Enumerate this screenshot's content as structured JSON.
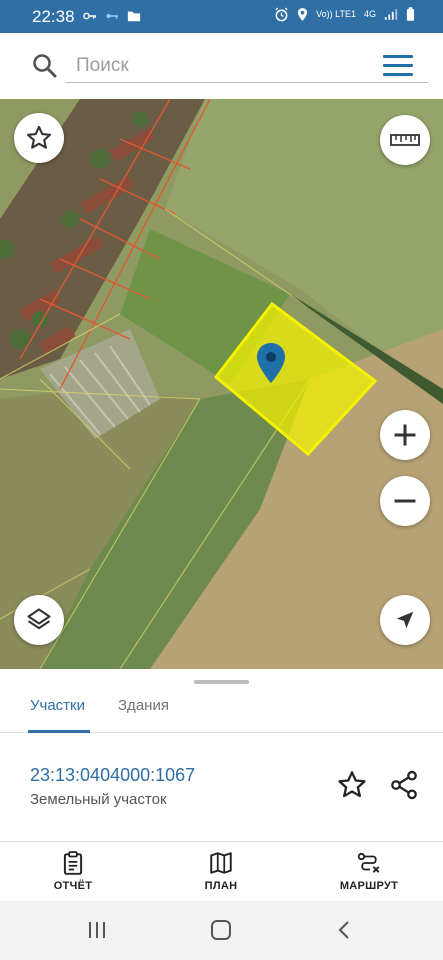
{
  "status_bar": {
    "time": "22:38",
    "network_label": "Vo)) LTE1",
    "network_type": "4G",
    "icons": [
      "key-icon",
      "wifi-key-icon",
      "folder-icon",
      "alarm-icon",
      "location-icon",
      "signal-icon",
      "battery-icon"
    ]
  },
  "search": {
    "placeholder": "Поиск"
  },
  "map": {
    "selected_parcel_color": "#f5f200",
    "pin_color": "#1f6fa8",
    "controls": [
      "favorite-star-icon",
      "ruler-icon",
      "zoom-in-icon",
      "zoom-out-icon",
      "layers-icon",
      "navigate-arrow-icon"
    ]
  },
  "sheet": {
    "tabs": [
      {
        "label": "Участки",
        "active": true
      },
      {
        "label": "Здания",
        "active": false
      }
    ],
    "parcel": {
      "cadastral_number": "23:13:0404000:1067",
      "type": "Земельный участок"
    }
  },
  "bottom_nav": {
    "items": [
      {
        "label": "ОТЧЁТ",
        "icon": "clipboard-icon"
      },
      {
        "label": "ПЛАН",
        "icon": "map-icon"
      },
      {
        "label": "МАРШРУТ",
        "icon": "route-icon"
      }
    ]
  },
  "colors": {
    "accent": "#2f6fa6",
    "status_bar": "#2f6fa6"
  }
}
